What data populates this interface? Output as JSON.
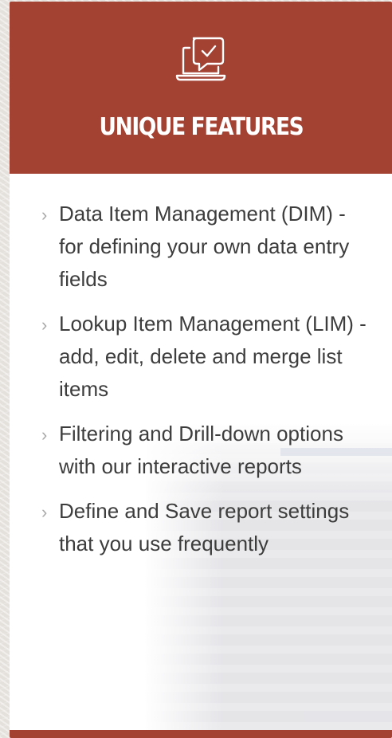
{
  "header": {
    "title": "UNIQUE FEATURES",
    "icon": "laptop-chat-check-icon"
  },
  "features": [
    {
      "text": "Data Item Management (DIM) - for defining your own data entry fields"
    },
    {
      "text": "Lookup Item Management (LIM) - add, edit, delete and merge list items"
    },
    {
      "text": "Filtering and Drill-down options with our interactive reports"
    },
    {
      "text": "Define and Save report settings that you use frequently"
    }
  ],
  "colors": {
    "accent": "#a34133",
    "text": "#3d3d3d",
    "bullet": "#a9a9a9"
  }
}
